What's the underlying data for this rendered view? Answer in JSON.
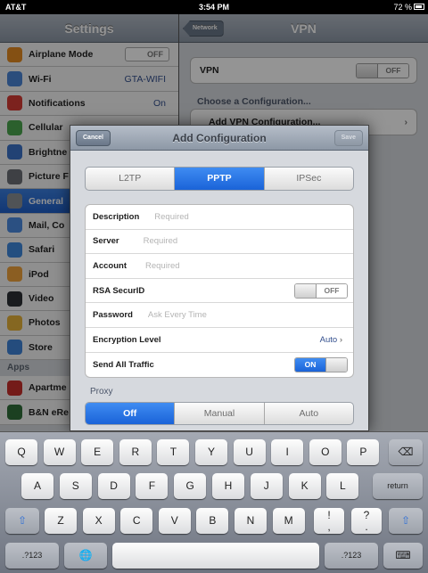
{
  "status_bar": {
    "carrier": "AT&T",
    "time": "3:54 PM",
    "battery": "72 %"
  },
  "settings": {
    "title": "Settings",
    "items": [
      {
        "label": "Airplane Mode",
        "value": "OFF",
        "kind": "toggle",
        "icon_color": "#e38a22"
      },
      {
        "label": "Wi-Fi",
        "value": "GTA-WIFI",
        "kind": "value",
        "icon_color": "#4a86d6"
      },
      {
        "label": "Notifications",
        "value": "On",
        "kind": "value",
        "icon_color": "#d63b35"
      },
      {
        "label": "Cellular",
        "value": "",
        "kind": "plain",
        "icon_color": "#4ba64f"
      },
      {
        "label": "Brightne",
        "value": "",
        "kind": "plain",
        "icon_color": "#3c73c8"
      },
      {
        "label": "Picture F",
        "value": "",
        "kind": "plain",
        "icon_color": "#6b6f76"
      },
      {
        "label": "General",
        "value": "",
        "kind": "selected",
        "icon_color": "#8b8f95"
      },
      {
        "label": "Mail, Co",
        "value": "",
        "kind": "plain",
        "icon_color": "#4a8ae0"
      },
      {
        "label": "Safari",
        "value": "",
        "kind": "plain",
        "icon_color": "#3f88dc"
      },
      {
        "label": "iPod",
        "value": "",
        "kind": "plain",
        "icon_color": "#f0a23c"
      },
      {
        "label": "Video",
        "value": "",
        "kind": "plain",
        "icon_color": "#2b2f35"
      },
      {
        "label": "Photos",
        "value": "",
        "kind": "plain",
        "icon_color": "#e6b23a"
      },
      {
        "label": "Store",
        "value": "",
        "kind": "plain",
        "icon_color": "#3e84d8"
      }
    ],
    "apps_header": "Apps",
    "apps": [
      {
        "label": "Apartme",
        "icon_color": "#c9302c"
      },
      {
        "label": "B&N eRe",
        "icon_color": "#2f6e3a"
      }
    ]
  },
  "vpn": {
    "back_label": "Network",
    "title": "VPN",
    "vpn_label": "VPN",
    "vpn_toggle": "OFF",
    "choose_label": "Choose a Configuration...",
    "add_config_label": "Add VPN Configuration..."
  },
  "modal": {
    "title": "Add Configuration",
    "cancel_label": "Cancel",
    "save_label": "Save",
    "protocol_tabs": [
      "L2TP",
      "PPTP",
      "IPSec"
    ],
    "selected_protocol": "PPTP",
    "fields": {
      "description": {
        "label": "Description",
        "placeholder": "Required"
      },
      "server": {
        "label": "Server",
        "placeholder": "Required"
      },
      "account": {
        "label": "Account",
        "placeholder": "Required"
      },
      "rsa": {
        "label": "RSA SecurID",
        "value": "OFF"
      },
      "password": {
        "label": "Password",
        "placeholder": "Ask Every Time"
      },
      "encryption": {
        "label": "Encryption Level",
        "value": "Auto"
      },
      "send_all": {
        "label": "Send All Traffic",
        "value": "ON"
      }
    },
    "proxy_label": "Proxy",
    "proxy_tabs": [
      "Off",
      "Manual",
      "Auto"
    ],
    "selected_proxy": "Off"
  },
  "keyboard": {
    "row1": [
      "Q",
      "W",
      "E",
      "R",
      "T",
      "Y",
      "U",
      "I",
      "O",
      "P"
    ],
    "row2": [
      "A",
      "S",
      "D",
      "F",
      "G",
      "H",
      "J",
      "K",
      "L"
    ],
    "row3": [
      "Z",
      "X",
      "C",
      "V",
      "B",
      "N",
      "M"
    ],
    "punct1": "!",
    "punct1_sub": ",",
    "punct2": "?",
    "punct2_sub": ".",
    "return_label": "return",
    "numbers_label": ".?123",
    "delete_glyph": "⌫",
    "shift_glyph": "⇧",
    "globe_glyph": "🌐",
    "hide_glyph": "⌨"
  },
  "colors": {
    "accent": "#1a63d8",
    "nav": "#8c97a5",
    "group_bg": "#d6d9de"
  }
}
